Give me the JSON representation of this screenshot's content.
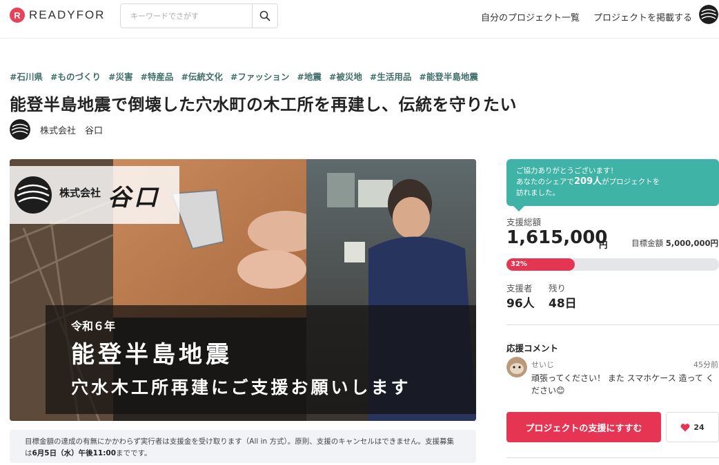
{
  "header": {
    "logo_mark": "R",
    "logo_text": "READYFOR",
    "search_placeholder": "キーワードでさがす",
    "nav": [
      "自分のプロジェクト一覧",
      "プロジェクトを掲載する"
    ]
  },
  "project": {
    "tags": [
      "#石川県",
      "#ものづくり",
      "#災害",
      "#特産品",
      "#伝統文化",
      "#ファッション",
      "#地震",
      "#被災地",
      "#生活用品",
      "#能登半島地震"
    ],
    "title": "能登半島地震で倒壊した穴水町の木工所を再建し、伝統を守りたい",
    "owner": "株式会社　谷口"
  },
  "visual": {
    "brand_small": "株式会社",
    "brand_big": "谷口",
    "caption_year": "令和６年",
    "caption_main": "能登半島地震",
    "caption_sub": "穴水木工所再建にご支援お願いします"
  },
  "notice": {
    "text_1": "目標金額の達成の有無にかかわらず実行者は支援金を受け取ります（All in 方式）。原則、支援のキャンセルはできません。支援募集は",
    "deadline": "6月5日（水）午後11:00",
    "text_2": "までです。"
  },
  "sidebar": {
    "share": {
      "line1": "ご協力ありがとうございます！",
      "line2_pre": "あなたのシェアで",
      "count": "209人",
      "line2_post": "がプロジェクトを",
      "line3": "訪れました。"
    },
    "total_label": "支援総額",
    "total_amount": "1,615,000",
    "total_unit": "円",
    "goal_label": "目標金額",
    "goal_value": "5,000,000円",
    "progress_label": "32%",
    "progress_fraction": 0.32,
    "supporters_label": "支援者",
    "supporters_value": "96人",
    "remaining_label": "残り",
    "remaining_value": "48日",
    "comments_title": "応援コメント",
    "comment": {
      "user": "せいじ",
      "time": "45分前",
      "text": "頑張ってください！ また スマホケース 造って ください😊"
    },
    "support_button": "プロジェクトの支援にすすむ",
    "like_count": "24"
  },
  "colors": {
    "brand_red": "#e63552",
    "teal": "#3fb3a6",
    "tag_green": "#3f6e6a"
  }
}
